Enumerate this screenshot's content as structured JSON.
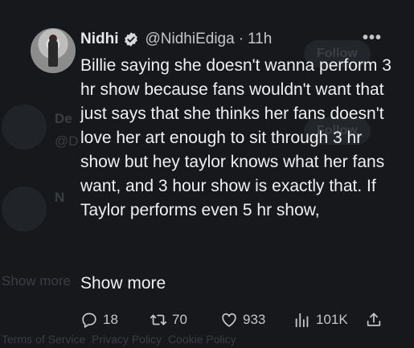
{
  "background_hint": {
    "follow_1": "Follow",
    "follow_2": "Follow",
    "name_2": "De",
    "handle_2": "@D",
    "name_3": "N",
    "show_more_bg": "Show more",
    "footer": "Terms of Service  Privacy Policy  Cookie Policy"
  },
  "tweet": {
    "author_name": "Nidhi",
    "handle": "@NidhiEdiga",
    "separator": "·",
    "time": "11h",
    "more_glyph": "•••",
    "text": "Billie saying she doesn't wanna perform 3 hr show because fans wouldn't want that just says that she thinks her fans doesn't love her art enough to sit through 3 hr show but hey taylor knows what her fans want, and 3 hour show is exactly that. If Taylor performs even 5 hr show,",
    "show_more": "Show more",
    "stats": {
      "replies": "18",
      "reposts": "70",
      "likes": "933",
      "views": "101K"
    }
  },
  "colors": {
    "background": "#16181c",
    "text": "#e7e9ea",
    "muted": "#c4c6c9",
    "verified": "#d9d9d9"
  },
  "icons": [
    "verified-badge-icon",
    "more-icon",
    "reply-icon",
    "repost-icon",
    "like-icon",
    "views-icon",
    "share-icon"
  ]
}
